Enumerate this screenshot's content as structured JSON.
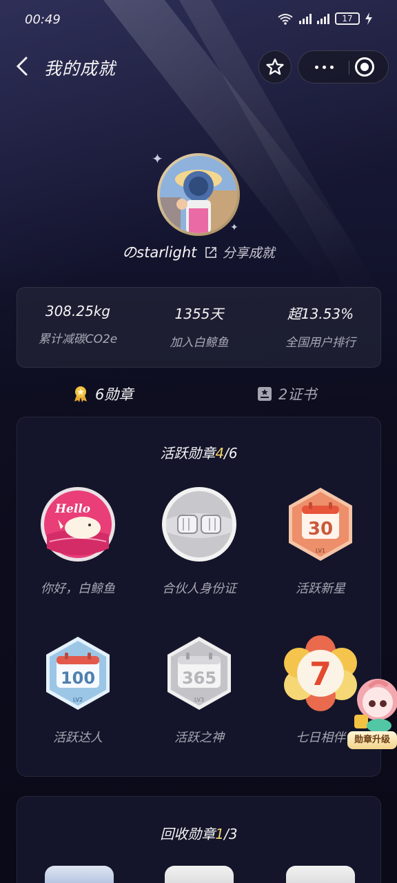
{
  "status_bar": {
    "time": "00:49",
    "battery": "17"
  },
  "nav": {
    "title": "我的成就"
  },
  "profile": {
    "username": "のstarlight",
    "share_label": "分享成就"
  },
  "stats": [
    {
      "value": "308.25kg",
      "label": "累计减碳CO2e"
    },
    {
      "value": "1355天",
      "label": "加入白鲸鱼"
    },
    {
      "value": "超13.53%",
      "label": "全国用户排行"
    }
  ],
  "tabs": {
    "badges": "6勋章",
    "certificates": "2证书"
  },
  "active_section": {
    "title_prefix": "活跃勋章",
    "count_earned": "4",
    "count_total": "/6",
    "badges": [
      {
        "name": "你好，白鲸鱼",
        "icon": "whale-hello-badge-icon",
        "art": "Hello"
      },
      {
        "name": "合伙人身份证",
        "icon": "fist-bump-badge-icon"
      },
      {
        "name": "活跃新星",
        "icon": "calendar-30-badge-icon",
        "art": "30",
        "level": "LV1"
      },
      {
        "name": "活跃达人",
        "icon": "calendar-100-badge-icon",
        "art": "100",
        "level": "LV2"
      },
      {
        "name": "活跃之神",
        "icon": "calendar-365-badge-icon",
        "art": "365",
        "level": "LV3"
      },
      {
        "name": "七日相伴",
        "icon": "seven-day-flower-badge-icon",
        "art": "7"
      }
    ]
  },
  "upgrade": {
    "label": "勋章升级"
  },
  "recycle_section": {
    "title_prefix": "回收勋章",
    "count_earned": "1",
    "count_total": "/3"
  },
  "colors": {
    "highlight": "#f6d36a",
    "background": "#0c0c1c",
    "card": "#14152a"
  }
}
